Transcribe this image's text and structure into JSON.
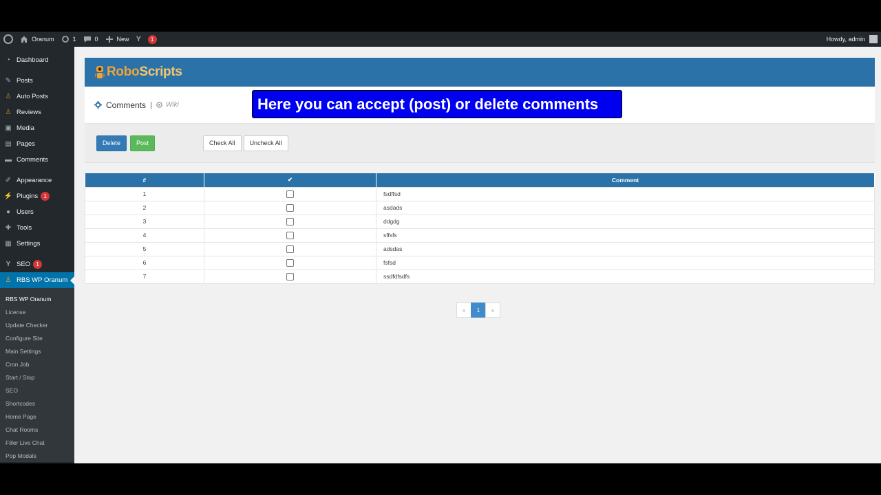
{
  "adminbar": {
    "site_name": "Oranum",
    "updates_count": "1",
    "comments_count": "0",
    "new_label": "New",
    "seo_badge": "1",
    "howdy": "Howdy, admin"
  },
  "sidebar": {
    "items": [
      {
        "label": "Dashboard",
        "icon": "dashboard-icon",
        "glyph": "◔"
      },
      {
        "label": "Posts",
        "icon": "pin-icon",
        "glyph": "✎"
      },
      {
        "label": "Auto Posts",
        "icon": "robot-icon",
        "glyph": "♙"
      },
      {
        "label": "Reviews",
        "icon": "robot-icon",
        "glyph": "♙"
      },
      {
        "label": "Media",
        "icon": "media-icon",
        "glyph": "▣"
      },
      {
        "label": "Pages",
        "icon": "pages-icon",
        "glyph": "▤"
      },
      {
        "label": "Comments",
        "icon": "comment-icon",
        "glyph": "▬"
      },
      {
        "label": "Appearance",
        "icon": "brush-icon",
        "glyph": "✐"
      },
      {
        "label": "Plugins",
        "icon": "plug-icon",
        "glyph": "⚡",
        "badge": "1"
      },
      {
        "label": "Users",
        "icon": "user-icon",
        "glyph": "●"
      },
      {
        "label": "Tools",
        "icon": "wrench-icon",
        "glyph": "✚"
      },
      {
        "label": "Settings",
        "icon": "settings-icon",
        "glyph": "▦"
      },
      {
        "label": "SEO",
        "icon": "yoast-icon",
        "glyph": "Y",
        "badge": "1"
      },
      {
        "label": "RBS WP Oranum",
        "icon": "robot-icon",
        "glyph": "♙"
      }
    ],
    "submenu": [
      "RBS WP Oranum",
      "License",
      "Update Checker",
      "Configure Site",
      "Main Settings",
      "Cron Job",
      "Start / Stop",
      "SEO",
      "Shortcodes",
      "Home Page",
      "Chat Rooms",
      "Filler Live Chat",
      "Pop Modals"
    ]
  },
  "brand": {
    "logo_text_a": "Robo",
    "logo_text_b": "Scripts"
  },
  "page": {
    "title": "Comments",
    "separator": "|",
    "wiki_label": "Wiki",
    "banner": "Here you can accept (post) or delete comments"
  },
  "actions": {
    "delete_label": "Delete",
    "post_label": "Post",
    "check_all_label": "Check All",
    "uncheck_all_label": "Uncheck All"
  },
  "table": {
    "headers": {
      "num": "#",
      "check": "✔",
      "comment": "Comment"
    },
    "rows": [
      {
        "num": "1",
        "comment": "fsdffsd"
      },
      {
        "num": "2",
        "comment": "asdads"
      },
      {
        "num": "3",
        "comment": "ddgdg"
      },
      {
        "num": "4",
        "comment": "sffsfs"
      },
      {
        "num": "5",
        "comment": "adsdas"
      },
      {
        "num": "6",
        "comment": "fsfsd"
      },
      {
        "num": "7",
        "comment": "ssdfdfsdfs"
      }
    ]
  },
  "pagination": {
    "prev": "«",
    "current": "1",
    "next": "»"
  }
}
